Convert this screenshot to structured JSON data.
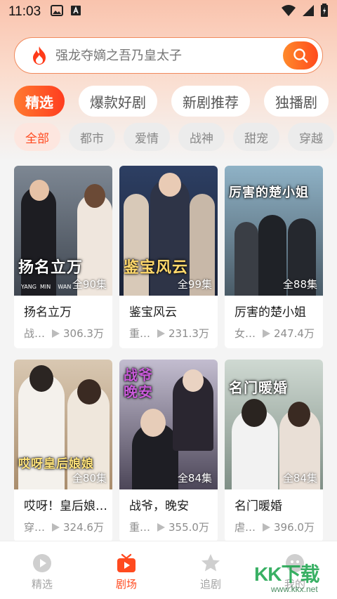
{
  "status_bar": {
    "time": "11:03"
  },
  "search": {
    "placeholder": "强龙夺嫡之吾乃皇太子"
  },
  "category_tabs": [
    {
      "label": "精选",
      "active": true
    },
    {
      "label": "爆款好剧",
      "active": false
    },
    {
      "label": "新剧推荐",
      "active": false
    },
    {
      "label": "独播剧",
      "active": false
    }
  ],
  "genres": [
    {
      "label": "全部",
      "active": true
    },
    {
      "label": "都市",
      "active": false
    },
    {
      "label": "爱情",
      "active": false
    },
    {
      "label": "战神",
      "active": false
    },
    {
      "label": "甜宠",
      "active": false
    },
    {
      "label": "穿越",
      "active": false
    }
  ],
  "dramas": [
    {
      "title": "扬名立万",
      "tag": "战…",
      "plays": "306.3万",
      "episodes": "全90集",
      "poster_text": "扬名立万",
      "poster_sub": "YANG  MIN    WAN",
      "bg": [
        "#7d8793",
        "#3f4650"
      ]
    },
    {
      "title": "鉴宝风云",
      "tag": "重…",
      "plays": "231.3万",
      "episodes": "全99集",
      "poster_text": "鉴宝风云",
      "poster_sub": "",
      "bg": [
        "#2d3f63",
        "#1a2236"
      ]
    },
    {
      "title": "厉害的楚小姐",
      "tag": "女…",
      "plays": "247.4万",
      "episodes": "全88集",
      "poster_text": "厉害的楚小姐",
      "poster_sub": "",
      "bg": [
        "#8fb2c6",
        "#4a5b67"
      ]
    },
    {
      "title": "哎呀！皇后娘…",
      "tag": "穿…",
      "plays": "324.6万",
      "episodes": "全80集",
      "poster_text": "哎呀皇后娘娘",
      "poster_sub": "",
      "bg": [
        "#d9c8b2",
        "#a98d6d"
      ]
    },
    {
      "title": "战爷，晚安",
      "tag": "重…",
      "plays": "355.0万",
      "episodes": "全84集",
      "poster_text": "战爷晚安",
      "poster_sub": "",
      "bg": [
        "#c3bdd0",
        "#4c4658"
      ]
    },
    {
      "title": "名门暖婚",
      "tag": "虐…",
      "plays": "396.0万",
      "episodes": "全84集",
      "poster_text": "名门暖婚",
      "poster_sub": "",
      "bg": [
        "#cfd9d2",
        "#7f8f86"
      ]
    }
  ],
  "bottom_nav": [
    {
      "label": "精选",
      "icon": "play-circle-icon",
      "active": false
    },
    {
      "label": "剧场",
      "icon": "tv-icon",
      "active": true
    },
    {
      "label": "追剧",
      "icon": "star-icon",
      "active": false
    },
    {
      "label": "我的",
      "icon": "user-icon",
      "active": false
    }
  ],
  "watermark": {
    "text": "KK下载",
    "sub": "www.kkx.net"
  },
  "colors": {
    "accent": "#ff4a1f",
    "search_border": "#f08a5d"
  }
}
